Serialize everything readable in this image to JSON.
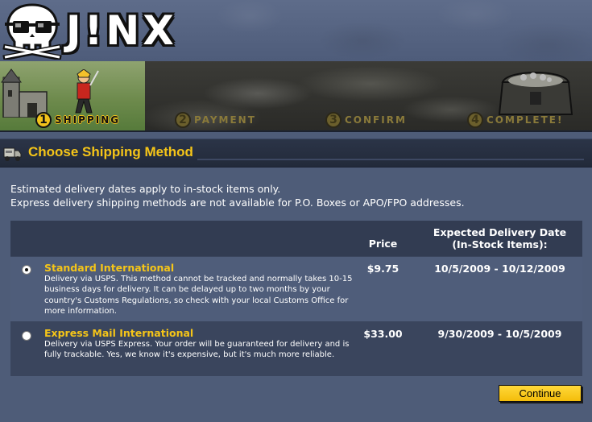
{
  "brand": {
    "logo_text": "J!NX"
  },
  "checkout_steps": [
    {
      "number": "1",
      "label": "SHIPPING",
      "active": true
    },
    {
      "number": "2",
      "label": "PAYMENT",
      "active": false
    },
    {
      "number": "3",
      "label": "CONFIRM",
      "active": false
    },
    {
      "number": "4",
      "label": "COMPLETE!",
      "active": false
    }
  ],
  "section": {
    "title": "Choose Shipping Method"
  },
  "info": {
    "line1": "Estimated delivery dates apply to in-stock items only.",
    "line2": "Express delivery shipping methods are not available for P.O. Boxes or APO/FPO addresses."
  },
  "table": {
    "headers": {
      "price": "Price",
      "date_line1": "Expected Delivery Date",
      "date_line2": "(In-Stock Items):"
    },
    "rows": [
      {
        "name": "Standard International",
        "description": "Delivery via USPS. This method cannot be tracked and normally takes 10-15 business days for delivery. It can be delayed up to two months by your country's Customs Regulations, so check with your local Customs Office for more information.",
        "price": "$9.75",
        "delivery": "10/5/2009 - 10/12/2009",
        "selected": true
      },
      {
        "name": "Express Mail International",
        "description": "Delivery via USPS Express. Your order will be guaranteed for delivery and is fully trackable. Yes, we know it's expensive, but it's much more reliable.",
        "price": "$33.00",
        "delivery": "9/30/2009 - 10/5/2009",
        "selected": false
      }
    ]
  },
  "buttons": {
    "continue": "Continue"
  },
  "colors": {
    "accent_yellow": "#f5c518",
    "background": "#4e5c78",
    "title_bar": "#2b3447",
    "selected_row": "#4f5d7a"
  },
  "icons": {
    "logo": "skull-with-glasses-icon",
    "section": "delivery-truck-icon"
  }
}
